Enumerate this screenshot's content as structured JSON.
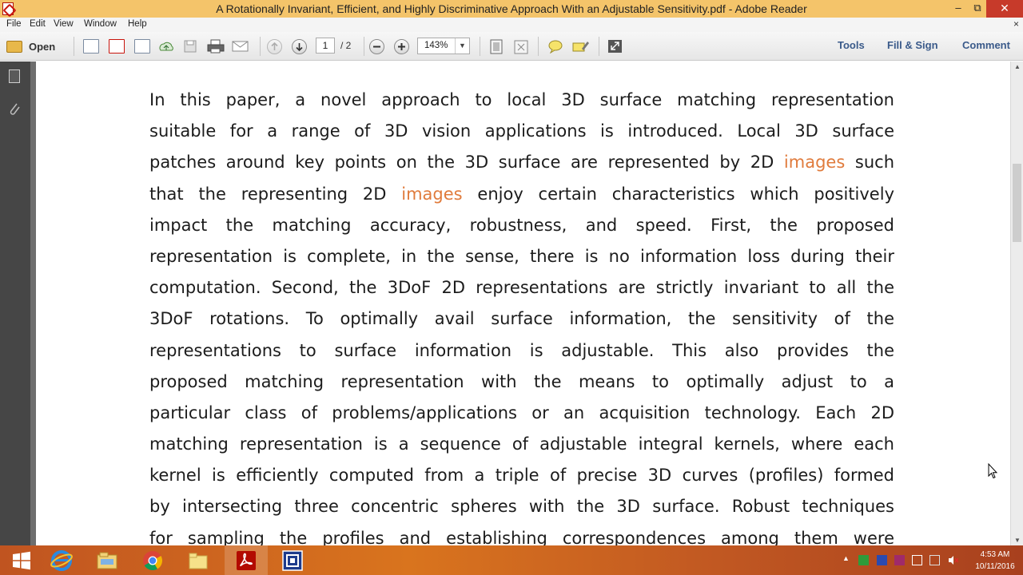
{
  "window": {
    "title": "A Rotationally Invariant, Efficient, and Highly Discriminative Approach With an Adjustable Sensitivity.pdf - Adobe Reader",
    "minimize_glyph": "–",
    "maximize_glyph": "⧉",
    "close_glyph": "✕"
  },
  "menu": {
    "items": [
      "File",
      "Edit",
      "View",
      "Window",
      "Help"
    ],
    "close_glyph": "×"
  },
  "toolbar": {
    "open_label": "Open",
    "page_current": "1",
    "page_total": "/ 2",
    "zoom_value": "143%",
    "zoom_arrow": "▼",
    "tools_label": "Tools",
    "fill_sign_label": "Fill & Sign",
    "comment_label": "Comment"
  },
  "document": {
    "lines": [
      [
        "In this paper, a novel approach to local 3D surface matching representation"
      ],
      [
        "suitable for a range of 3D vision applications is introduced. Local 3D surface"
      ],
      [
        "patches around key points on the 3D surface are represented by 2D ",
        "images",
        " such"
      ],
      [
        "that the representing 2D ",
        "images",
        " enjoy certain characteristics which positively"
      ],
      [
        "impact the matching accuracy, robustness, and speed. First, the proposed"
      ],
      [
        "representation is complete, in the sense, there is no information loss during their"
      ],
      [
        "computation. Second, the 3DoF 2D representations are strictly invariant to all the"
      ],
      [
        "3DoF rotations. To optimally avail surface information, the sensitivity of the"
      ],
      [
        "representations to surface information is adjustable. This also provides the"
      ],
      [
        "proposed matching representation with the means to optimally adjust to a"
      ],
      [
        "particular class of problems/applications or an acquisition technology. Each 2D"
      ],
      [
        "matching representation is a sequence of adjustable integral kernels, where each"
      ],
      [
        "kernel is efficiently computed from a triple of precise 3D curves (profiles) formed"
      ],
      [
        "by intersecting three concentric spheres with the 3D surface. Robust techniques"
      ],
      [
        "for sampling the profiles and establishing correspondences among them were"
      ]
    ],
    "highlight_color": "#e07b3c"
  },
  "taskbar": {
    "time": "4:53 AM",
    "date": "10/11/2016",
    "apps": [
      "start-button",
      "internet-explorer-icon",
      "file-explorer-icon",
      "chrome-icon",
      "folder-icon",
      "adobe-reader-icon",
      "app-icon"
    ]
  }
}
